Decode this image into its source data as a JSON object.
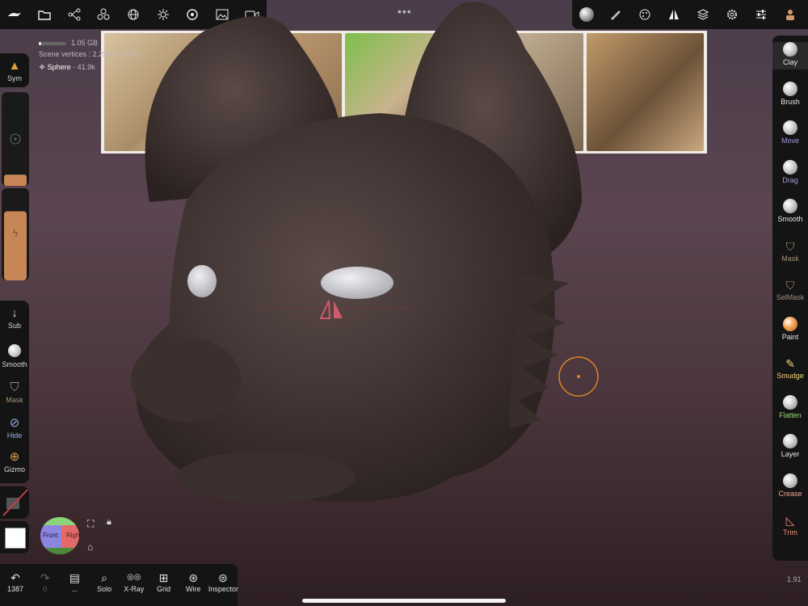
{
  "top_toolbar_left": [
    "brand-icon",
    "folder-icon",
    "scene-graph-icon",
    "shapes-icon",
    "sphere-icon",
    "light-icon",
    "material-icon",
    "image-icon",
    "camera-icon"
  ],
  "top_toolbar_right": [
    "material-ball-icon",
    "brush-tool-icon",
    "palette-icon",
    "symmetry-icon",
    "layers-icon",
    "settings-icon",
    "sliders-icon",
    "avatar-icon"
  ],
  "stats": {
    "memory": "1.05 GB",
    "scene_vertices": "Scene vertices : 2.29M / 2.37M",
    "object": "Sphere",
    "object_vertices": "41.9k",
    "memory_fraction": 0.1
  },
  "left_sidebar": {
    "sym_label": "Sym",
    "sub_label": "Sub",
    "smooth_label": "Smooth",
    "mask_label": "Mask",
    "hide_label": "Hide",
    "gizmo_label": "Gizmo",
    "radius_fraction": 0.12,
    "intensity_fraction": 0.75,
    "active_color": "#ffffff"
  },
  "right_sidebar": {
    "tools": [
      {
        "label": "Clay",
        "color": "#e6e6e6"
      },
      {
        "label": "Brush",
        "color": "#e6e6e6"
      },
      {
        "label": "Move",
        "color": "#a99ae0"
      },
      {
        "label": "Drag",
        "color": "#a99ae0"
      },
      {
        "label": "Smooth",
        "color": "#e6e6e6"
      },
      {
        "label": "Mask",
        "color": "#a28f76"
      },
      {
        "label": "SelMask",
        "color": "#a28f76"
      },
      {
        "label": "Paint",
        "color": "#e6e6e6"
      },
      {
        "label": "Smudge",
        "color": "#f2d27a"
      },
      {
        "label": "Flatten",
        "color": "#9fd67a"
      },
      {
        "label": "Layer",
        "color": "#e6e6e6"
      },
      {
        "label": "Crease",
        "color": "#f2a58a"
      },
      {
        "label": "Trim",
        "color": "#f08a78"
      }
    ]
  },
  "view_cube": {
    "front": "Front",
    "right": "Righ"
  },
  "bottom_toolbar": [
    {
      "label": "1387",
      "icon": "undo-icon"
    },
    {
      "label": "0",
      "icon": "redo-icon"
    },
    {
      "label": "...",
      "icon": "stack-icon"
    },
    {
      "label": "Solo",
      "icon": "search-icon"
    },
    {
      "label": "X-Ray",
      "icon": "glasses-icon"
    },
    {
      "label": "Grid",
      "icon": "grid-icon"
    },
    {
      "label": "Wire",
      "icon": "wire-icon"
    },
    {
      "label": "Inspector",
      "icon": "inspector-icon"
    }
  ],
  "version": "1.91"
}
